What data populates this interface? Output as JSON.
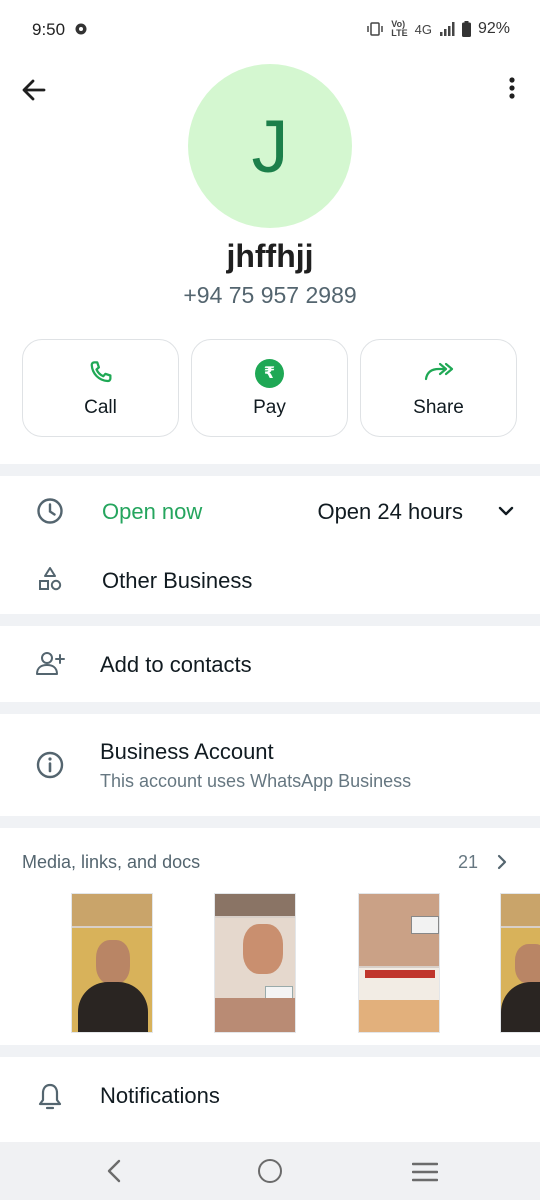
{
  "status_bar": {
    "time": "9:50",
    "network": "4G",
    "battery": "92%"
  },
  "profile": {
    "avatar_initial": "J",
    "name": "jhffhjj",
    "phone": "+94 75 957 2989",
    "actions": [
      {
        "label": "Call",
        "icon": "phone-icon"
      },
      {
        "label": "Pay",
        "icon": "rupee-icon",
        "symbol": "₹"
      },
      {
        "label": "Share",
        "icon": "share-forward-icon"
      }
    ]
  },
  "business_info": {
    "hours_status": "Open now",
    "hours_detail": "Open 24 hours",
    "category": "Other Business"
  },
  "contacts": {
    "add_label": "Add to contacts"
  },
  "account": {
    "title": "Business Account",
    "subtitle": "This account uses WhatsApp Business"
  },
  "media": {
    "title": "Media, links, and docs",
    "count": "21"
  },
  "notifications": {
    "label": "Notifications"
  },
  "colors": {
    "accent": "#25a55e",
    "avatar_bg": "#d4f7d0",
    "avatar_text": "#1c7f4a"
  }
}
